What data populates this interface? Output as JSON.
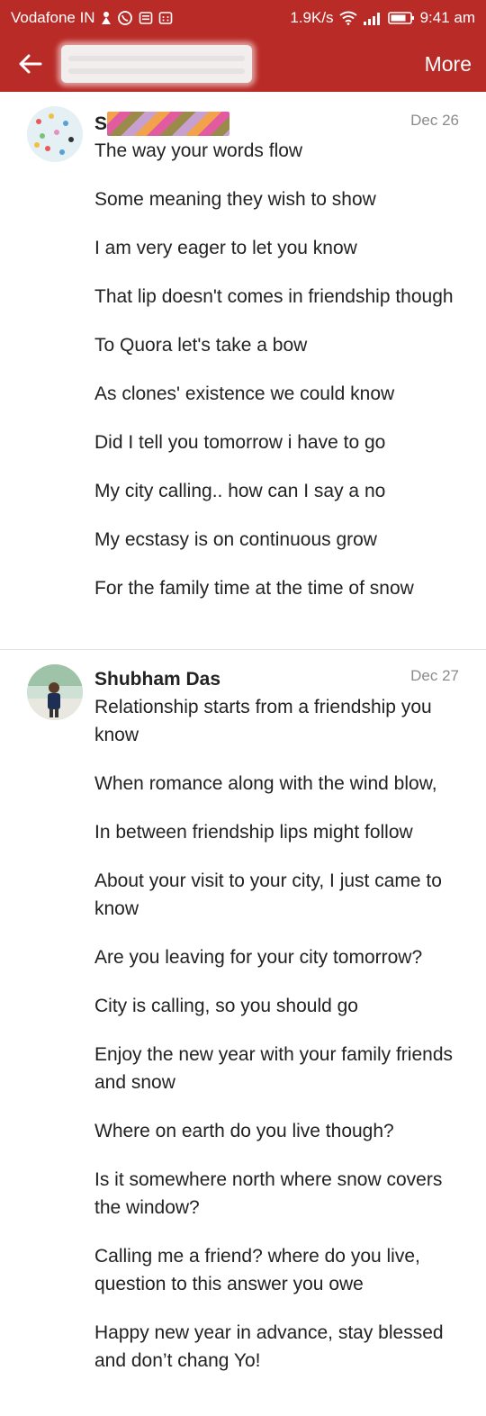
{
  "status_bar": {
    "carrier": "Vodafone IN",
    "network_speed": "1.9K/s",
    "time": "9:41 am"
  },
  "app_bar": {
    "more_label": "More"
  },
  "messages": [
    {
      "sender": "S",
      "date": "Dec 26",
      "lines": [
        "The way your words flow",
        "Some meaning they wish to show",
        "I am very eager to let you know",
        "That lip doesn't comes in friendship though",
        "To Quora let's take a bow",
        "As clones' existence we could know",
        "Did I tell you tomorrow i have to go",
        "My city calling.. how can I say a no",
        "My ecstasy is on continuous grow",
        "For the family time at the time of snow"
      ]
    },
    {
      "sender": "Shubham Das",
      "date": "Dec 27",
      "lines": [
        "Relationship starts from a friendship you know",
        "When romance along with the wind blow,",
        "In between friendship lips might follow",
        "About your visit to your city, I just came to know",
        "Are you leaving for your city tomorrow?",
        "City is calling, so you should go",
        "Enjoy the new year with your family friends and snow",
        "Where on earth do you live though?",
        "Is it somewhere north where snow covers the window?",
        "Calling me a friend? where do you live, question to this answer you owe",
        "Happy new year in advance, stay blessed and don’t chang Yo!"
      ]
    }
  ],
  "colors": {
    "brand": "#b92b27",
    "date_text": "#8b8b8b"
  },
  "icons": [
    "back-arrow-icon",
    "wifi-icon",
    "signal-icon",
    "battery-icon",
    "whatsapp-icon"
  ]
}
